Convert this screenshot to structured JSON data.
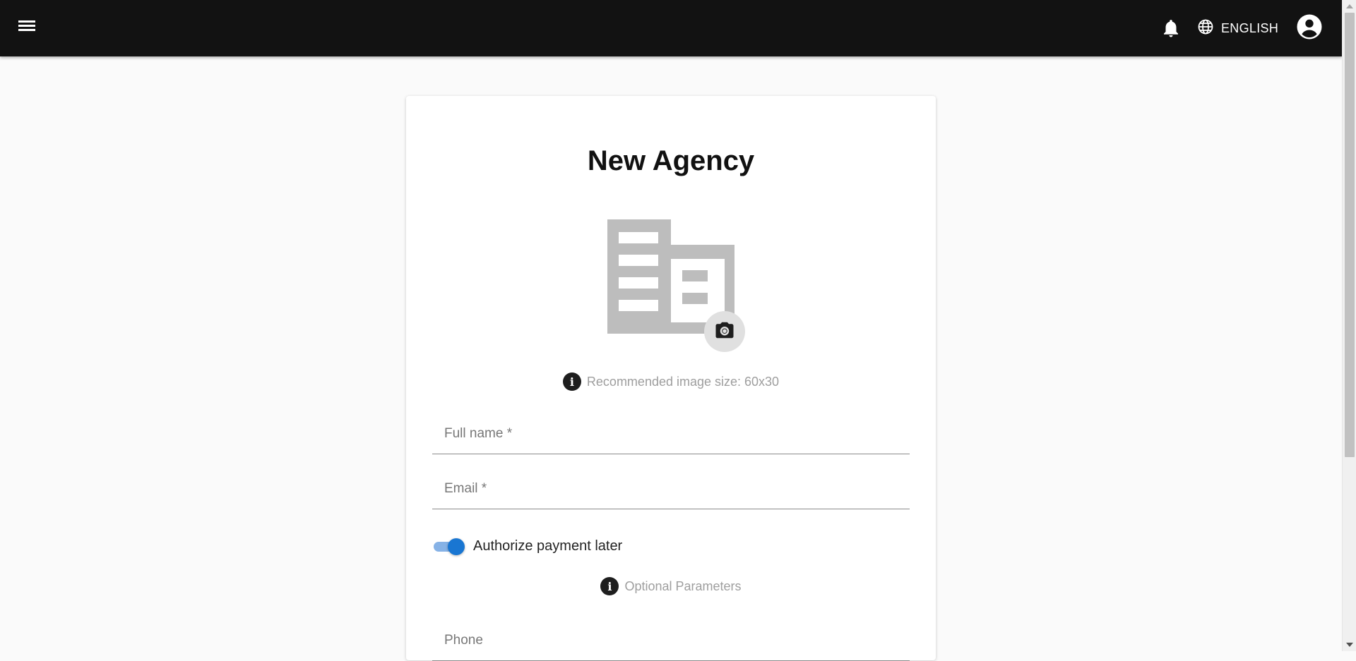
{
  "header": {
    "menu_icon": "menu-icon",
    "notifications_icon": "bell-icon",
    "language_icon": "globe-icon",
    "language_label": "ENGLISH",
    "account_icon": "account-circle-icon"
  },
  "form": {
    "title": "New Agency",
    "avatar_icon": "building-icon",
    "upload_icon": "camera-icon",
    "image_hint": "Recommended image size: 60x30",
    "full_name_label": "Full name *",
    "full_name_value": "",
    "email_label": "Email *",
    "email_value": "",
    "pay_later_label": "Authorize payment later",
    "pay_later_checked": true,
    "optional_hint": "Optional Parameters",
    "phone_label": "Phone",
    "phone_value": ""
  },
  "colors": {
    "header_bg": "#121212",
    "toggle_active": "#1976d2",
    "toggle_track": "#86b2e6",
    "placeholder_icon": "#bdbdbd"
  }
}
